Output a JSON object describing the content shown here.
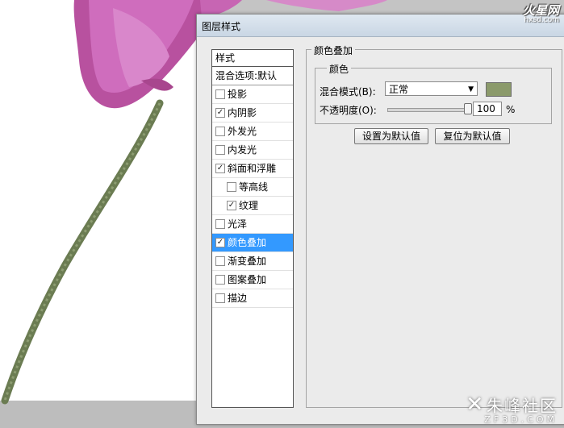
{
  "site_logo_top": {
    "text": "火星网",
    "sub": "hxsd.com"
  },
  "dialog": {
    "title": "图层样式",
    "styles_header": "样式",
    "blend_options": "混合选项:默认",
    "style_items": [
      {
        "label": "投影",
        "checked": false,
        "indent": false,
        "selected": false
      },
      {
        "label": "内阴影",
        "checked": true,
        "indent": false,
        "selected": false
      },
      {
        "label": "外发光",
        "checked": false,
        "indent": false,
        "selected": false
      },
      {
        "label": "内发光",
        "checked": false,
        "indent": false,
        "selected": false
      },
      {
        "label": "斜面和浮雕",
        "checked": true,
        "indent": false,
        "selected": false
      },
      {
        "label": "等高线",
        "checked": false,
        "indent": true,
        "selected": false
      },
      {
        "label": "纹理",
        "checked": true,
        "indent": true,
        "selected": false
      },
      {
        "label": "光泽",
        "checked": false,
        "indent": false,
        "selected": false
      },
      {
        "label": "颜色叠加",
        "checked": true,
        "indent": false,
        "selected": true
      },
      {
        "label": "渐变叠加",
        "checked": false,
        "indent": false,
        "selected": false
      },
      {
        "label": "图案叠加",
        "checked": false,
        "indent": false,
        "selected": false
      },
      {
        "label": "描边",
        "checked": false,
        "indent": false,
        "selected": false
      }
    ],
    "section_title": "颜色叠加",
    "subsection_title": "颜色",
    "blend_mode_label": "混合模式(B):",
    "blend_mode_value": "正常",
    "overlay_color": "#8b9a6b",
    "opacity_label": "不透明度(O):",
    "opacity_value": "100",
    "opacity_unit": "%",
    "opacity_percent": 100,
    "set_default_button": "设置为默认值",
    "reset_default_button": "复位为默认值"
  },
  "watermark": {
    "text": "朱峰社区",
    "sub": "ZF3D.COM"
  }
}
